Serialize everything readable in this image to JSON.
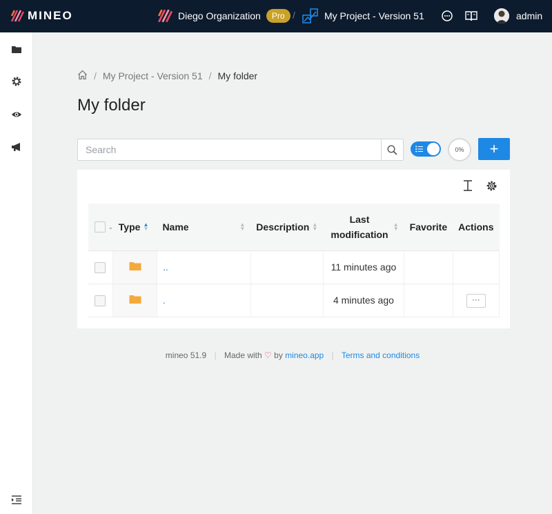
{
  "topbar": {
    "brand": "MINEO",
    "organization": "Diego Organization",
    "plan_badge": "Pro",
    "separator": "/",
    "project": "My Project - Version 51",
    "user": "admin"
  },
  "sidebar": {
    "items": [
      {
        "icon": "folder-icon"
      },
      {
        "icon": "gear-icon"
      },
      {
        "icon": "eye-icon"
      },
      {
        "icon": "megaphone-icon"
      }
    ]
  },
  "breadcrumb": {
    "items": [
      "My Project - Version 51",
      "My folder"
    ],
    "separator": "/"
  },
  "page": {
    "title": "My folder"
  },
  "search": {
    "placeholder": "Search",
    "value": ""
  },
  "toolbar": {
    "progress": "0%",
    "add_label": "+"
  },
  "table": {
    "headers": {
      "type": "Type",
      "name": "Name",
      "description": "Description",
      "last_modification_1": "Last",
      "last_modification_2": "modification",
      "favorite": "Favorite",
      "actions": "Actions"
    },
    "rows": [
      {
        "name": "..",
        "description": "",
        "modified": "11 minutes ago",
        "has_actions": false
      },
      {
        "name": ".",
        "description": "",
        "modified": "4 minutes ago",
        "has_actions": true
      }
    ],
    "actions_label": "···"
  },
  "footer": {
    "version": "mineo 51.9",
    "made_with": "Made with",
    "by": "by",
    "link_text": "mineo.app",
    "terms": "Terms and conditions"
  },
  "colors": {
    "topbar_bg": "#0d1b2e",
    "accent": "#1e88e5",
    "pro_badge": "#c9a227",
    "folder": "#f4a93b"
  }
}
